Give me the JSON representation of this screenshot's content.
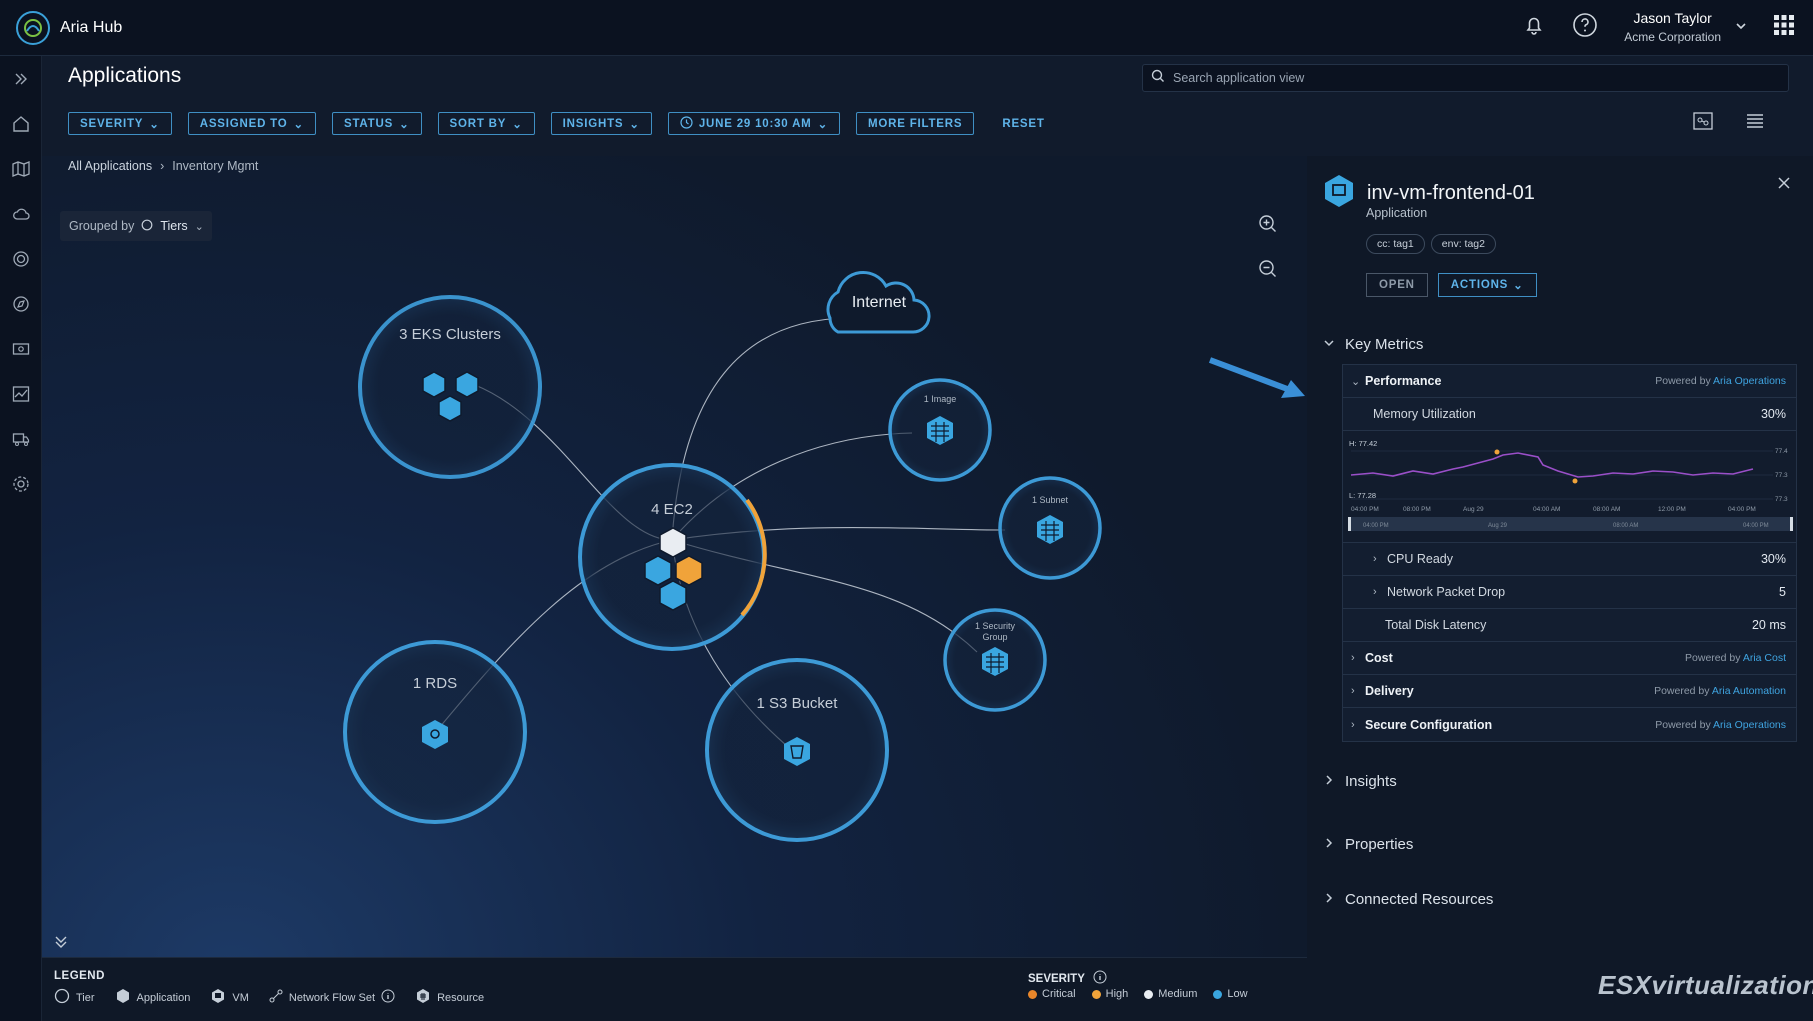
{
  "app": {
    "name": "Aria Hub"
  },
  "user": {
    "name": "Jason Taylor",
    "org": "Acme Corporation"
  },
  "page": {
    "title": "Applications"
  },
  "search": {
    "placeholder": "Search application view"
  },
  "filters": [
    "SEVERITY",
    "ASSIGNED TO",
    "STATUS",
    "SORT BY",
    "INSIGHTS",
    "JUNE 29 10:30 AM",
    "MORE FILTERS",
    "RESET"
  ],
  "breadcrumb": {
    "root": "All Applications",
    "separator": "›",
    "current": "Inventory Mgmt"
  },
  "groupby": {
    "label": "Grouped by",
    "value": "Tiers"
  },
  "graph": {
    "internet": "Internet",
    "nodes": {
      "eks": "3 EKS Clusters",
      "ec2": "4 EC2",
      "rds": "1 RDS",
      "s3": "1 S3 Bucket",
      "image": "1 Image",
      "subnet": "1 Subnet",
      "secgroup_line1": "1 Security",
      "secgroup_line2": "Group"
    }
  },
  "legend": {
    "title": "LEGEND",
    "items": [
      "Tier",
      "Application",
      "VM",
      "Network Flow Set",
      "Resource"
    ],
    "severity_title": "SEVERITY",
    "severity": [
      {
        "label": "Critical",
        "color": "#e8862a"
      },
      {
        "label": "High",
        "color": "#f0a33a"
      },
      {
        "label": "Medium",
        "color": "#e9edf2"
      },
      {
        "label": "Low",
        "color": "#3aa6e0"
      }
    ]
  },
  "panel": {
    "title": "inv-vm-frontend-01",
    "subtitle": "Application",
    "tags": [
      "cc: tag1",
      "env: tag2"
    ],
    "open": "OPEN",
    "actions": "ACTIONS",
    "key_metrics": "Key Metrics",
    "performance": {
      "title": "Performance",
      "powered": "Powered by",
      "source": "Aria Operations"
    },
    "memory": {
      "label": "Memory Utilization",
      "value": "30%"
    },
    "chart": {
      "high": "H: 77.42",
      "low": "L: 77.28",
      "ticks_x": [
        "04:00 PM",
        "08:00 PM",
        "Aug 29",
        "04:00 AM",
        "08:00 AM",
        "12:00 PM",
        "04:00 PM"
      ],
      "ticks_y": [
        "77.4",
        "77.3",
        "77.3"
      ],
      "range_labels": [
        "04:00 PM",
        "Aug 29",
        "08:00 AM",
        "04:00 PM"
      ]
    },
    "cpu": {
      "label": "CPU Ready",
      "value": "30%"
    },
    "packet": {
      "label": "Network Packet Drop",
      "value": "5"
    },
    "disk": {
      "label": "Total Disk Latency",
      "value": "20 ms"
    },
    "cost": {
      "title": "Cost",
      "powered": "Powered by",
      "source": "Aria Cost"
    },
    "delivery": {
      "title": "Delivery",
      "powered": "Powered by",
      "source": "Aria Automation"
    },
    "secure": {
      "title": "Secure Configuration",
      "powered": "Powered by",
      "source": "Aria Operations"
    },
    "sections": [
      "Insights",
      "Properties",
      "Connected Resources"
    ]
  },
  "watermark": "ESXvirtualization",
  "colors": {
    "accent": "#3aa6e0",
    "ring": "#3d9ad6",
    "warning": "#f0a33a",
    "background": "#0d1626"
  }
}
